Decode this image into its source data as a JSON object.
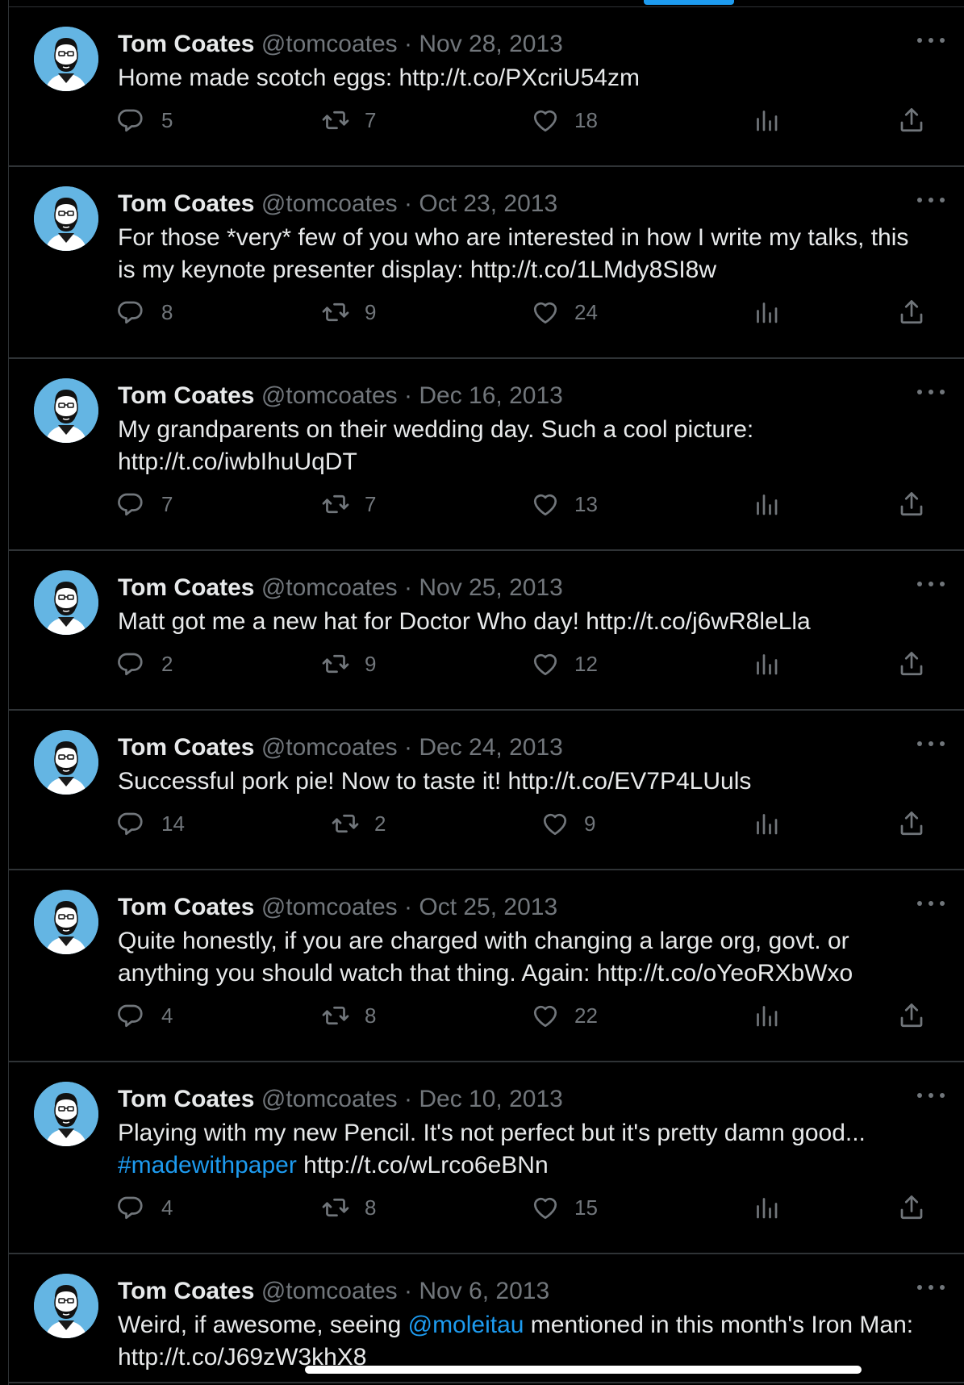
{
  "accent_color": "#1d9bf0",
  "icons": {
    "reply": "reply-bubble-icon",
    "retweet": "retweet-arrows-icon",
    "like": "heart-icon",
    "views": "bar-chart-icon",
    "share": "share-upload-icon",
    "more": "more-dots-icon"
  },
  "tweets": [
    {
      "name": "Tom Coates",
      "handle": "@tomcoates",
      "sep": "·",
      "date": "Nov 28, 2013",
      "text_parts": [
        {
          "t": "Home made scotch eggs: http://t.co/PXcriU54zm"
        }
      ],
      "replies": "5",
      "retweets": "7",
      "likes": "18"
    },
    {
      "name": "Tom Coates",
      "handle": "@tomcoates",
      "sep": "·",
      "date": "Oct 23, 2013",
      "text_parts": [
        {
          "t": "For those *very* few of you who are interested in how I write my talks, this is my keynote presenter display: http://t.co/1LMdy8SI8w"
        }
      ],
      "replies": "8",
      "retweets": "9",
      "likes": "24"
    },
    {
      "name": "Tom Coates",
      "handle": "@tomcoates",
      "sep": "·",
      "date": "Dec 16, 2013",
      "text_parts": [
        {
          "t": "My grandparents on their wedding day. Such a cool picture: http://t.co/iwbIhuUqDT"
        }
      ],
      "replies": "7",
      "retweets": "7",
      "likes": "13"
    },
    {
      "name": "Tom Coates",
      "handle": "@tomcoates",
      "sep": "·",
      "date": "Nov 25, 2013",
      "text_parts": [
        {
          "t": "Matt got me a new hat for Doctor Who day! http://t.co/j6wR8leLla"
        }
      ],
      "replies": "2",
      "retweets": "9",
      "likes": "12"
    },
    {
      "name": "Tom Coates",
      "handle": "@tomcoates",
      "sep": "·",
      "date": "Dec 24, 2013",
      "text_parts": [
        {
          "t": "Successful pork pie! Now to taste it! http://t.co/EV7P4LUuls"
        }
      ],
      "replies": "14",
      "retweets": "2",
      "likes": "9"
    },
    {
      "name": "Tom Coates",
      "handle": "@tomcoates",
      "sep": "·",
      "date": "Oct 25, 2013",
      "text_parts": [
        {
          "t": "Quite honestly, if you are charged with changing a large org, govt. or anything you should watch that thing. Again: http://t.co/oYeoRXbWxo"
        }
      ],
      "replies": "4",
      "retweets": "8",
      "likes": "22"
    },
    {
      "name": "Tom Coates",
      "handle": "@tomcoates",
      "sep": "·",
      "date": "Dec 10, 2013",
      "text_parts": [
        {
          "t": "Playing with my new Pencil. It's not perfect but it's pretty damn good... "
        },
        {
          "t": "#madewithpaper",
          "k": "hashtag"
        },
        {
          "t": " http://t.co/wLrco6eBNn"
        }
      ],
      "replies": "4",
      "retweets": "8",
      "likes": "15"
    },
    {
      "name": "Tom Coates",
      "handle": "@tomcoates",
      "sep": "·",
      "date": "Nov 6, 2013",
      "text_parts": [
        {
          "t": "Weird, if awesome, seeing "
        },
        {
          "t": "@moleitau",
          "k": "mention"
        },
        {
          "t": " mentioned in this month's Iron Man: http://t.co/J69zW3khX8"
        }
      ]
    }
  ]
}
